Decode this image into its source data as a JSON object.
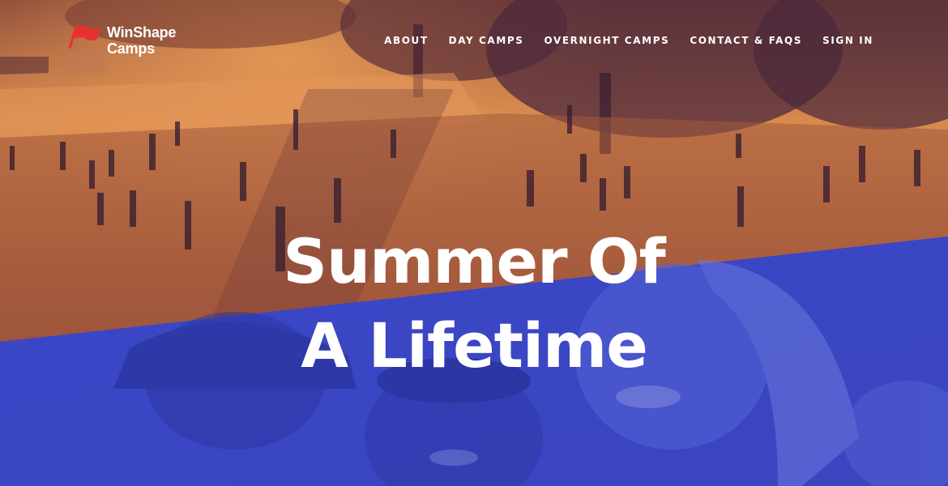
{
  "brand": {
    "name_line1": "WinShape",
    "name_line2": "Camps",
    "flag_icon": "red-flag-icon",
    "flag_color": "#e8312f"
  },
  "nav": {
    "items": [
      {
        "label": "ABOUT"
      },
      {
        "label": "DAY CAMPS"
      },
      {
        "label": "OVERNIGHT CAMPS"
      },
      {
        "label": "CONTACT & FAQS"
      },
      {
        "label": "SIGN IN"
      }
    ]
  },
  "hero": {
    "line1": "Summer Of",
    "line2": "A Lifetime"
  },
  "colors": {
    "orange_overlay": "#c36b3b",
    "blue_overlay": "#3d48c8",
    "text": "#ffffff"
  }
}
